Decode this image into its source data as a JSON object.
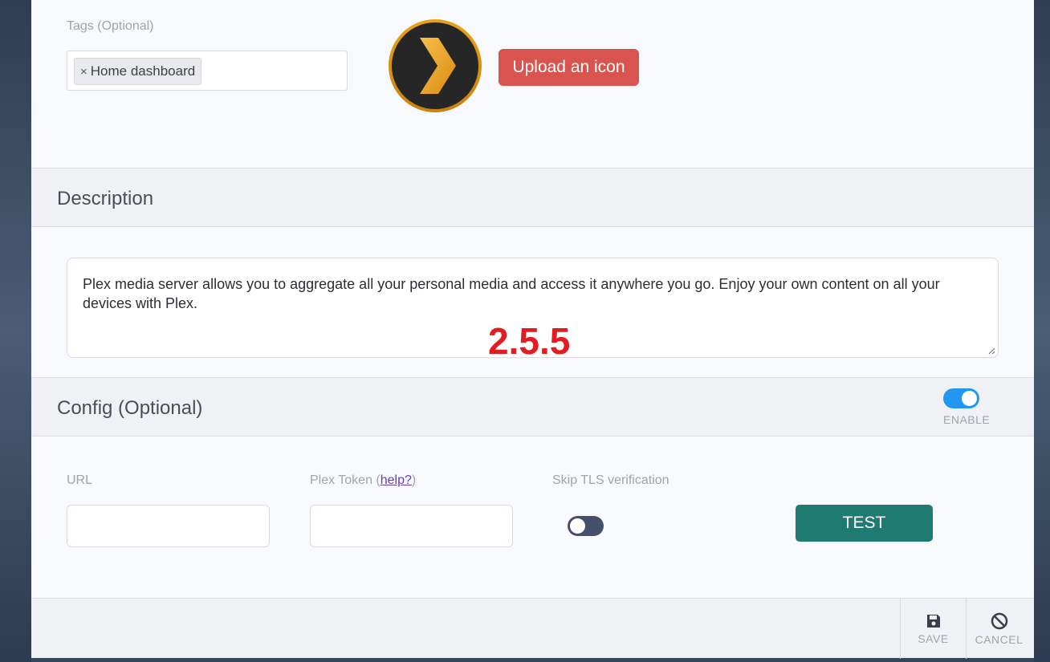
{
  "tags": {
    "label": "Tags (Optional)",
    "items": [
      {
        "label": "Home dashboard",
        "remove": "×"
      }
    ]
  },
  "icon": {
    "name": "plex-logo-icon",
    "upload_label": "Upload an icon"
  },
  "description": {
    "title": "Description",
    "text": "Plex media server allows you to aggregate all your personal media and access it anywhere you go. Enjoy your own content on all your devices with Plex."
  },
  "version_overlay": "2.5.5",
  "config": {
    "title": "Config (Optional)",
    "enable_label": "ENABLE",
    "enabled": true,
    "url_label": "URL",
    "url_value": "",
    "token_label_prefix": "Plex Token (",
    "token_help": "help?",
    "token_label_suffix": ")",
    "token_value": "",
    "tls_label": "Skip TLS verification",
    "tls_enabled": false,
    "test_label": "TEST"
  },
  "footer": {
    "save_label": "SAVE",
    "cancel_label": "CANCEL"
  },
  "colors": {
    "upload": "#d9534f",
    "test": "#1f7a72",
    "toggle_on": "#2196f3",
    "version": "#e31b23"
  }
}
